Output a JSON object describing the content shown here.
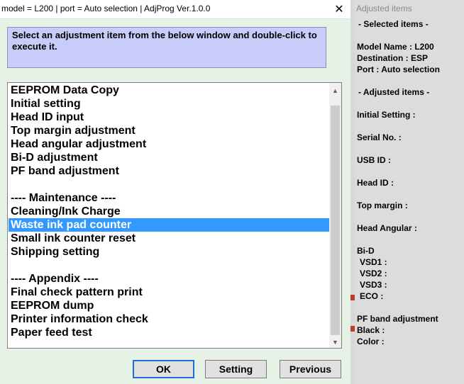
{
  "dialog": {
    "title": "model = L200 | port = Auto selection | AdjProg Ver.1.0.0",
    "close_glyph": "✕",
    "instruction": "Select an adjustment item from the below window and double-click to execute it.",
    "items": [
      {
        "label": "EEPROM Data Copy",
        "selected": false
      },
      {
        "label": "Initial setting",
        "selected": false
      },
      {
        "label": "Head ID input",
        "selected": false
      },
      {
        "label": "Top margin adjustment",
        "selected": false
      },
      {
        "label": "Head angular adjustment",
        "selected": false
      },
      {
        "label": "Bi-D adjustment",
        "selected": false
      },
      {
        "label": "PF band adjustment",
        "selected": false
      },
      {
        "label": "",
        "selected": false
      },
      {
        "label": "---- Maintenance ----",
        "selected": false
      },
      {
        "label": "Cleaning/Ink Charge",
        "selected": false
      },
      {
        "label": "Waste ink pad counter",
        "selected": true
      },
      {
        "label": "Small ink counter reset",
        "selected": false
      },
      {
        "label": "Shipping setting",
        "selected": false
      },
      {
        "label": "",
        "selected": false
      },
      {
        "label": "---- Appendix ----",
        "selected": false
      },
      {
        "label": "Final check pattern print",
        "selected": false
      },
      {
        "label": "EEPROM dump",
        "selected": false
      },
      {
        "label": "Printer information check",
        "selected": false
      },
      {
        "label": "Paper feed test",
        "selected": false
      }
    ],
    "scroll_up_glyph": "▲",
    "scroll_down_glyph": "▼",
    "buttons": {
      "ok": "OK",
      "setting": "Setting",
      "previous": "Previous"
    },
    "selection_color": "#3399ff",
    "instruction_bg": "#c8ccf8"
  },
  "side_panel": {
    "title": "Adjusted items",
    "selected_header": "- Selected items -",
    "model_name": "Model Name : L200",
    "destination": "Destination : ESP",
    "port": "Port : Auto selection",
    "adjusted_header": "- Adjusted items -",
    "initial_setting": "Initial Setting :",
    "serial_no": "Serial No. :",
    "usb_id": "USB ID :",
    "head_id": "Head ID :",
    "top_margin": "Top margin :",
    "head_angular": "Head Angular :",
    "bid": "Bi-D",
    "vsd1": "VSD1 :",
    "vsd2": "VSD2 :",
    "vsd3": "VSD3 :",
    "eco": "ECO  :",
    "pf_band": "PF band adjustment",
    "black": "Black :",
    "color": "Color :"
  }
}
